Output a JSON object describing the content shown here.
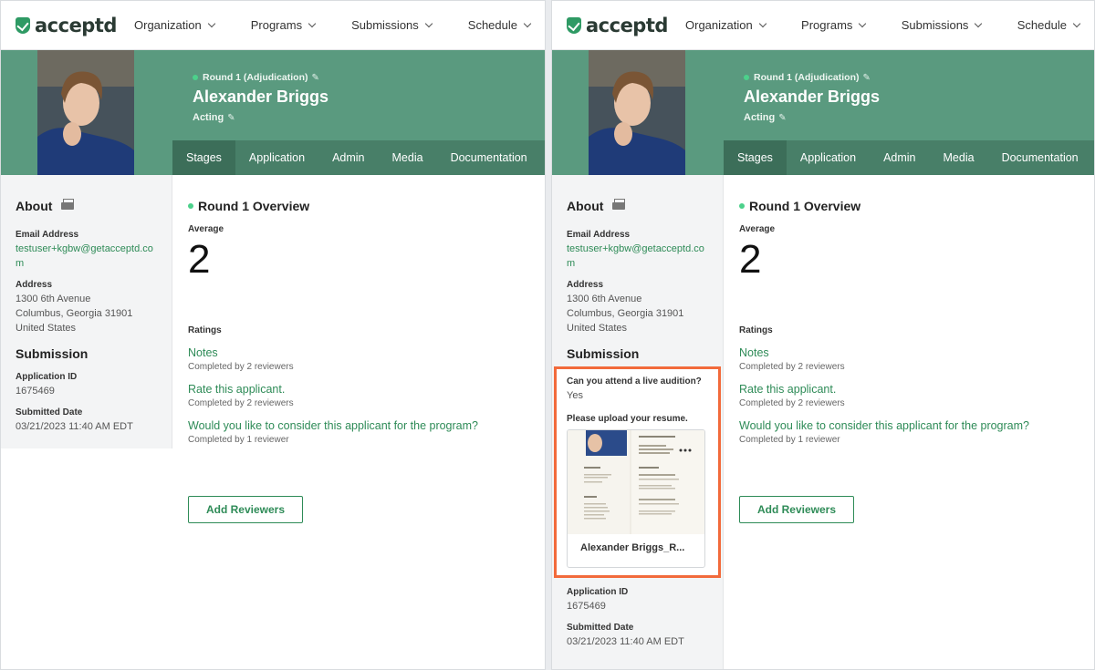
{
  "brand": {
    "name": "acceptd"
  },
  "nav": [
    "Organization",
    "Programs",
    "Submissions",
    "Schedule"
  ],
  "header": {
    "stage": "Round 1 (Adjudication)",
    "name": "Alexander Briggs",
    "program": "Acting"
  },
  "tabs": [
    "Stages",
    "Application",
    "Admin",
    "Media",
    "Documentation"
  ],
  "sidebar": {
    "about_title": "About",
    "email_label": "Email Address",
    "email_value": "testuser+kgbw@getacceptd.com",
    "address_label": "Address",
    "address_line1": "1300 6th Avenue",
    "address_line2": "Columbus, Georgia 31901",
    "address_line3": "United States",
    "submission_title": "Submission",
    "question1_label": "Can you attend a live audition?",
    "question1_value": "Yes",
    "question2_label": "Please upload your resume.",
    "resume_filename": "Alexander Briggs_R...",
    "app_id_label": "Application ID",
    "app_id_value": "1675469",
    "submitted_label": "Submitted Date",
    "submitted_value": "03/21/2023 11:40 AM EDT"
  },
  "overview": {
    "title": "Round 1 Overview",
    "average_label": "Average",
    "average_value": "2",
    "ratings_label": "Ratings",
    "ratings": [
      {
        "title": "Notes",
        "sub": "Completed by 2 reviewers"
      },
      {
        "title": "Rate this applicant.",
        "sub": "Completed by 2 reviewers"
      },
      {
        "title": "Would you like to consider this applicant for the program?",
        "sub": "Completed by 1 reviewer"
      }
    ],
    "add_reviewers": "Add Reviewers"
  },
  "colors": {
    "accent": "#2e8b57",
    "header": "#5a9a7f",
    "tabs": "#487f68",
    "highlight": "#f26a3b"
  }
}
